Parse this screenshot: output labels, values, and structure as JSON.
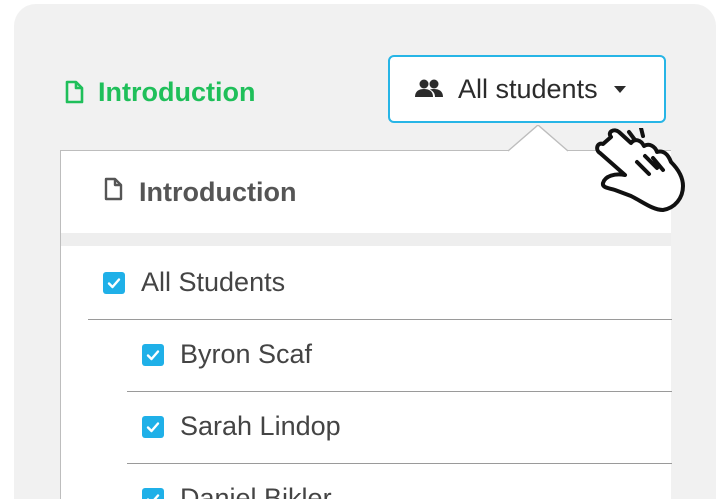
{
  "header": {
    "lesson_title": "Introduction",
    "filter_label": "All students"
  },
  "dropdown": {
    "title": "Introduction",
    "all_label": "All Students",
    "all_checked": true,
    "students": [
      {
        "name": "Byron Scaf",
        "checked": true
      },
      {
        "name": "Sarah Lindop",
        "checked": true
      },
      {
        "name": "Daniel Bikler",
        "checked": true
      }
    ]
  },
  "colors": {
    "accent_green": "#1fbf5a",
    "accent_blue": "#27b5e6",
    "checkbox": "#1fb0e8"
  },
  "icons": [
    "document-icon",
    "users-icon",
    "caret-down-icon",
    "checkbox-checked-icon",
    "pointer-hand-icon"
  ]
}
